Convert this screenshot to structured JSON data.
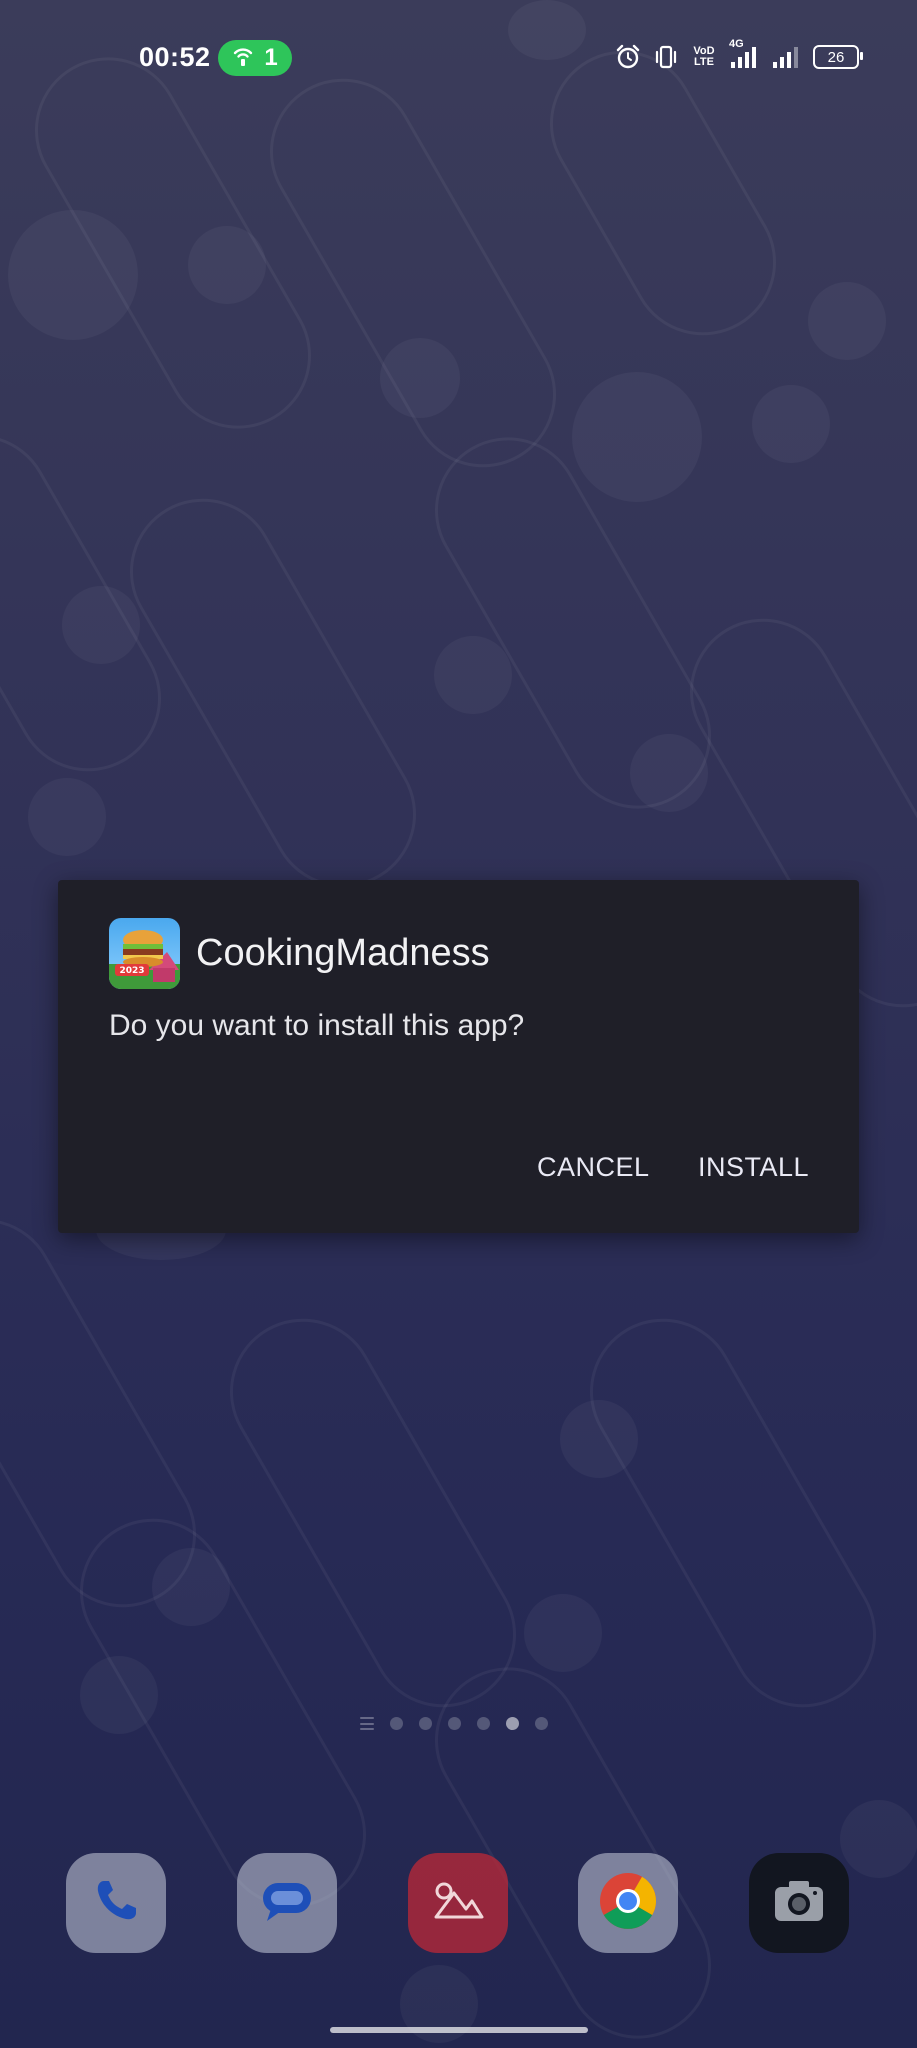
{
  "status_bar": {
    "time": "00:52",
    "hotspot_count": "1",
    "network_label_top": "VoD",
    "network_label_bottom": "LTE",
    "network_type": "4G",
    "battery_level": "26",
    "icons": [
      "alarm-icon",
      "vibrate-icon",
      "volte-icon",
      "signal-4g-icon",
      "signal-icon",
      "battery-icon"
    ]
  },
  "dialog": {
    "app_name": "CookingMadness",
    "icon_badge": "2023",
    "message": "Do you want to install this app?",
    "cancel_label": "CANCEL",
    "install_label": "INSTALL"
  },
  "home": {
    "page_count": 6,
    "active_page": 5,
    "dock_apps": [
      "Phone",
      "Messages",
      "Gallery",
      "Chrome",
      "Camera"
    ]
  },
  "colors": {
    "dialog_bg": "#1f1f28",
    "hotspot_green": "#2ec55a",
    "wallpaper_top": "#3b3c5a",
    "wallpaper_bottom": "#22264f"
  }
}
